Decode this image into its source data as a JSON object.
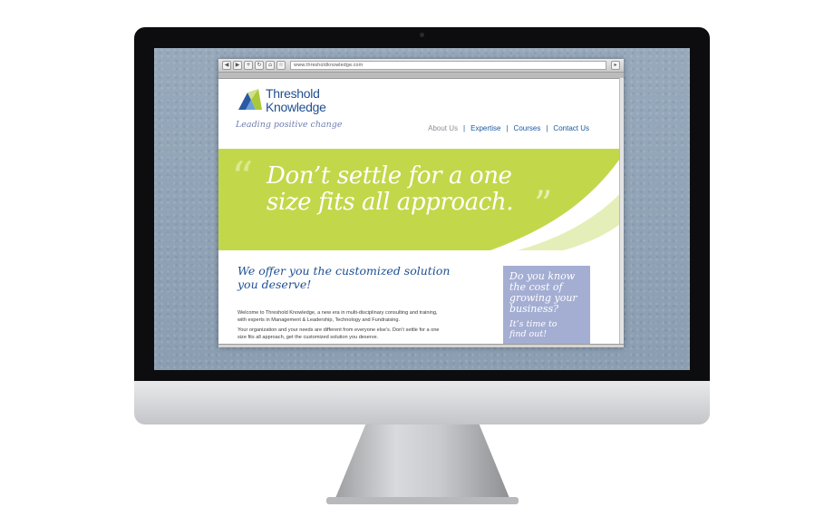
{
  "browser": {
    "url": "www.thresholdknowledge.com",
    "nav_buttons": [
      "◀",
      "▶",
      "+",
      "↻",
      "⌂",
      "☆"
    ],
    "go_icon": "▸"
  },
  "site": {
    "logo": {
      "line1": "Threshold",
      "line2": "Knowledge"
    },
    "tagline": "Leading positive change",
    "nav": {
      "items": [
        "About Us",
        "Expertise",
        "Courses",
        "Contact Us"
      ],
      "separator": "|",
      "active_index": 0
    },
    "hero": {
      "quote_open": "“",
      "quote_close": "”",
      "line1": "Don’t settle for a one",
      "line2": "size fits all approach."
    },
    "main": {
      "heading_line1": "We offer you the customized solution",
      "heading_line2": "you deserve!",
      "para1_line1": "Welcome to Threshold Knowledge, a new era in multi-disciplinary consulting and training,",
      "para1_line2": "with experts in Management & Leadership, Technology and Fundraising.",
      "para2_line1": "Your organization and your needs are different from everyone else’s. Don’t settle for a one",
      "para2_line2": "size fits all approach, get the customized solution you deserve."
    },
    "sidebox": {
      "line1": "Do you know",
      "line2": "the cost of",
      "line3": "growing your",
      "line4": "business?",
      "line5": "It’s time to",
      "line6": "find out!"
    }
  },
  "colors": {
    "brand_blue": "#1d4f91",
    "hero_green": "#c2d84a",
    "sidebox_lavender": "#a4aed3",
    "wall_blue": "#8fa2b5"
  }
}
